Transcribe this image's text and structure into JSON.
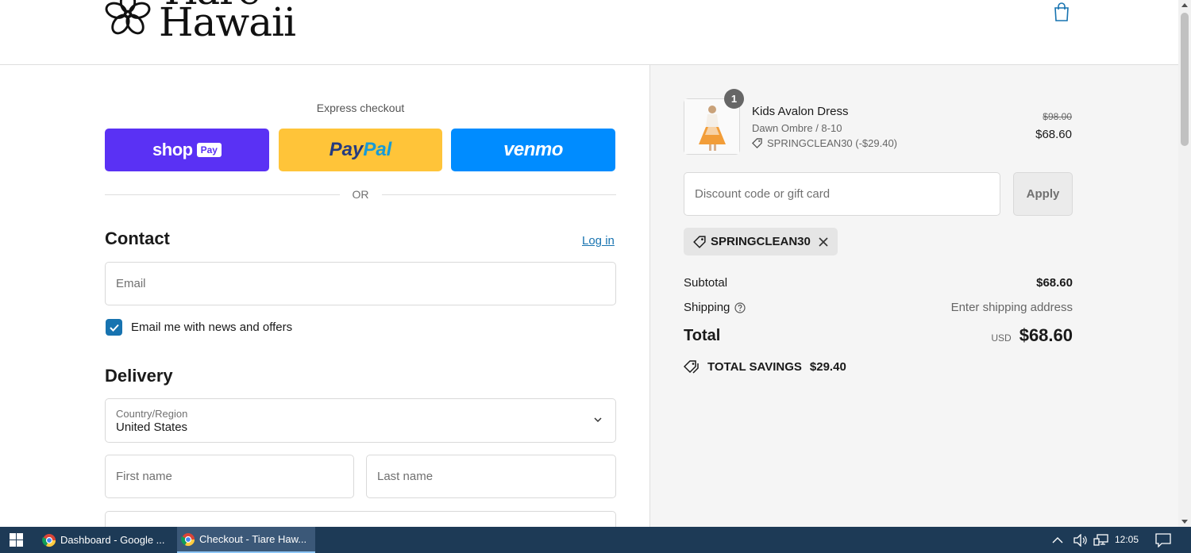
{
  "header": {
    "logo_line1": "Tiare",
    "logo_line2": "Hawaii"
  },
  "express": {
    "label": "Express checkout",
    "shoppay_text": "shop",
    "shoppay_badge": "Pay",
    "paypal_part1": "Pay",
    "paypal_part2": "Pal",
    "venmo_text": "venmo",
    "or_text": "OR"
  },
  "contact": {
    "title": "Contact",
    "login_label": "Log in",
    "email_placeholder": "Email",
    "newsletter_label": "Email me with news and offers",
    "newsletter_checked": true
  },
  "delivery": {
    "title": "Delivery",
    "country_label": "Country/Region",
    "country_value": "United States",
    "first_name_placeholder": "First name",
    "last_name_placeholder": "Last name"
  },
  "summary": {
    "item": {
      "quantity": "1",
      "name": "Kids Avalon Dress",
      "variant": "Dawn Ombre / 8-10",
      "discount": "SPRINGCLEAN30 (-$29.40)",
      "price_old": "$98.00",
      "price_new": "$68.60"
    },
    "discount_placeholder": "Discount code or gift card",
    "apply_label": "Apply",
    "applied_code": "SPRINGCLEAN30",
    "subtotal_label": "Subtotal",
    "subtotal_value": "$68.60",
    "shipping_label": "Shipping",
    "shipping_value": "Enter shipping address",
    "total_label": "Total",
    "currency": "USD",
    "total_value": "$68.60",
    "savings_label": "TOTAL SAVINGS",
    "savings_value": "$29.40"
  },
  "taskbar": {
    "items": [
      {
        "label": "Dashboard - Google ..."
      },
      {
        "label": "Checkout - Tiare Haw..."
      }
    ],
    "time": "12:05"
  },
  "colors": {
    "shoppay": "#5a31f4",
    "paypal": "#ffc439",
    "venmo": "#008cff",
    "link": "#1773b0",
    "taskbar": "#1d3a56"
  }
}
